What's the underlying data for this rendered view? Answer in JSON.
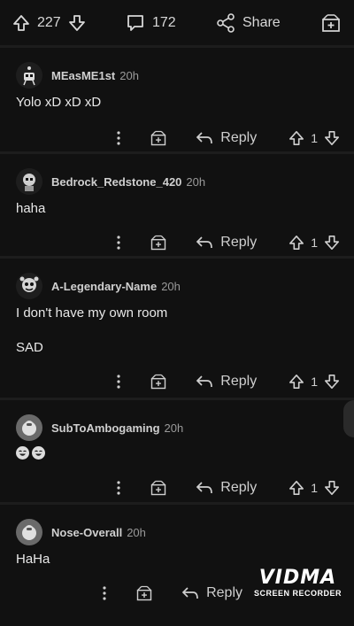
{
  "post_bar": {
    "score": "227",
    "comment_count": "172",
    "share_label": "Share"
  },
  "comments": [
    {
      "username": "MEasME1st",
      "time": "20h",
      "paragraphs": [
        "Yolo xD xD xD"
      ],
      "reply_label": "Reply",
      "votes": "1"
    },
    {
      "username": "Bedrock_Redstone_420",
      "time": "20h",
      "paragraphs": [
        "haha"
      ],
      "reply_label": "Reply",
      "votes": "1"
    },
    {
      "username": "A-Legendary-Name",
      "time": "20h",
      "paragraphs": [
        "I don't have my own room",
        "SAD"
      ],
      "reply_label": "Reply",
      "votes": "1"
    },
    {
      "username": "SubToAmbogaming",
      "time": "20h",
      "paragraphs": [],
      "reply_label": "Reply",
      "votes": "1"
    },
    {
      "username": "Nose-Overall",
      "time": "20h",
      "paragraphs": [
        "HaHa"
      ],
      "reply_label": "Reply",
      "votes": ""
    }
  ],
  "watermark": {
    "logo": "VIDMA",
    "subtitle": "SCREEN RECORDER"
  },
  "icons": [
    "upvote-icon",
    "downvote-icon",
    "comment-icon",
    "share-icon",
    "award-icon",
    "more-icon",
    "reply-icon"
  ]
}
